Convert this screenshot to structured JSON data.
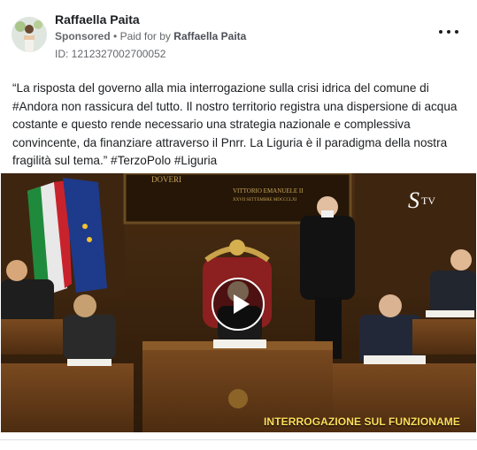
{
  "post": {
    "author": "Raffaella Paita",
    "sponsored": "Sponsored",
    "paid_for_prefix": "Paid for by",
    "paid_for_name": "Raffaella Paita",
    "ad_id": "ID: 1212327002700052",
    "text": "“La risposta del governo alla mia interrogazione sulla crisi idrica del comune di #Andora non rassicura del tutto. Il nostro territorio registra una dispersione di acqua costante e questo rende necessario una strategia nazionale e complessiva convincente, da finanziare attraverso il Pnrr. La Liguria è il paradigma della nostra fragilità sul tema.” #TerzoPolo #Liguria"
  },
  "video": {
    "logo_letter": "S",
    "logo_suffix": "TV",
    "caption": "INTERROGAZIONE SUL FUNZIONAME",
    "plaque_line1": "DOVERI",
    "plaque_line2": "VITTORIO EMANUELE II",
    "plaque_line3": "XXVII SETTEMBRE MDCCCLXI"
  },
  "colors": {
    "text": "#1c1e21",
    "meta": "#65676b",
    "caption": "#ffdf5b"
  }
}
